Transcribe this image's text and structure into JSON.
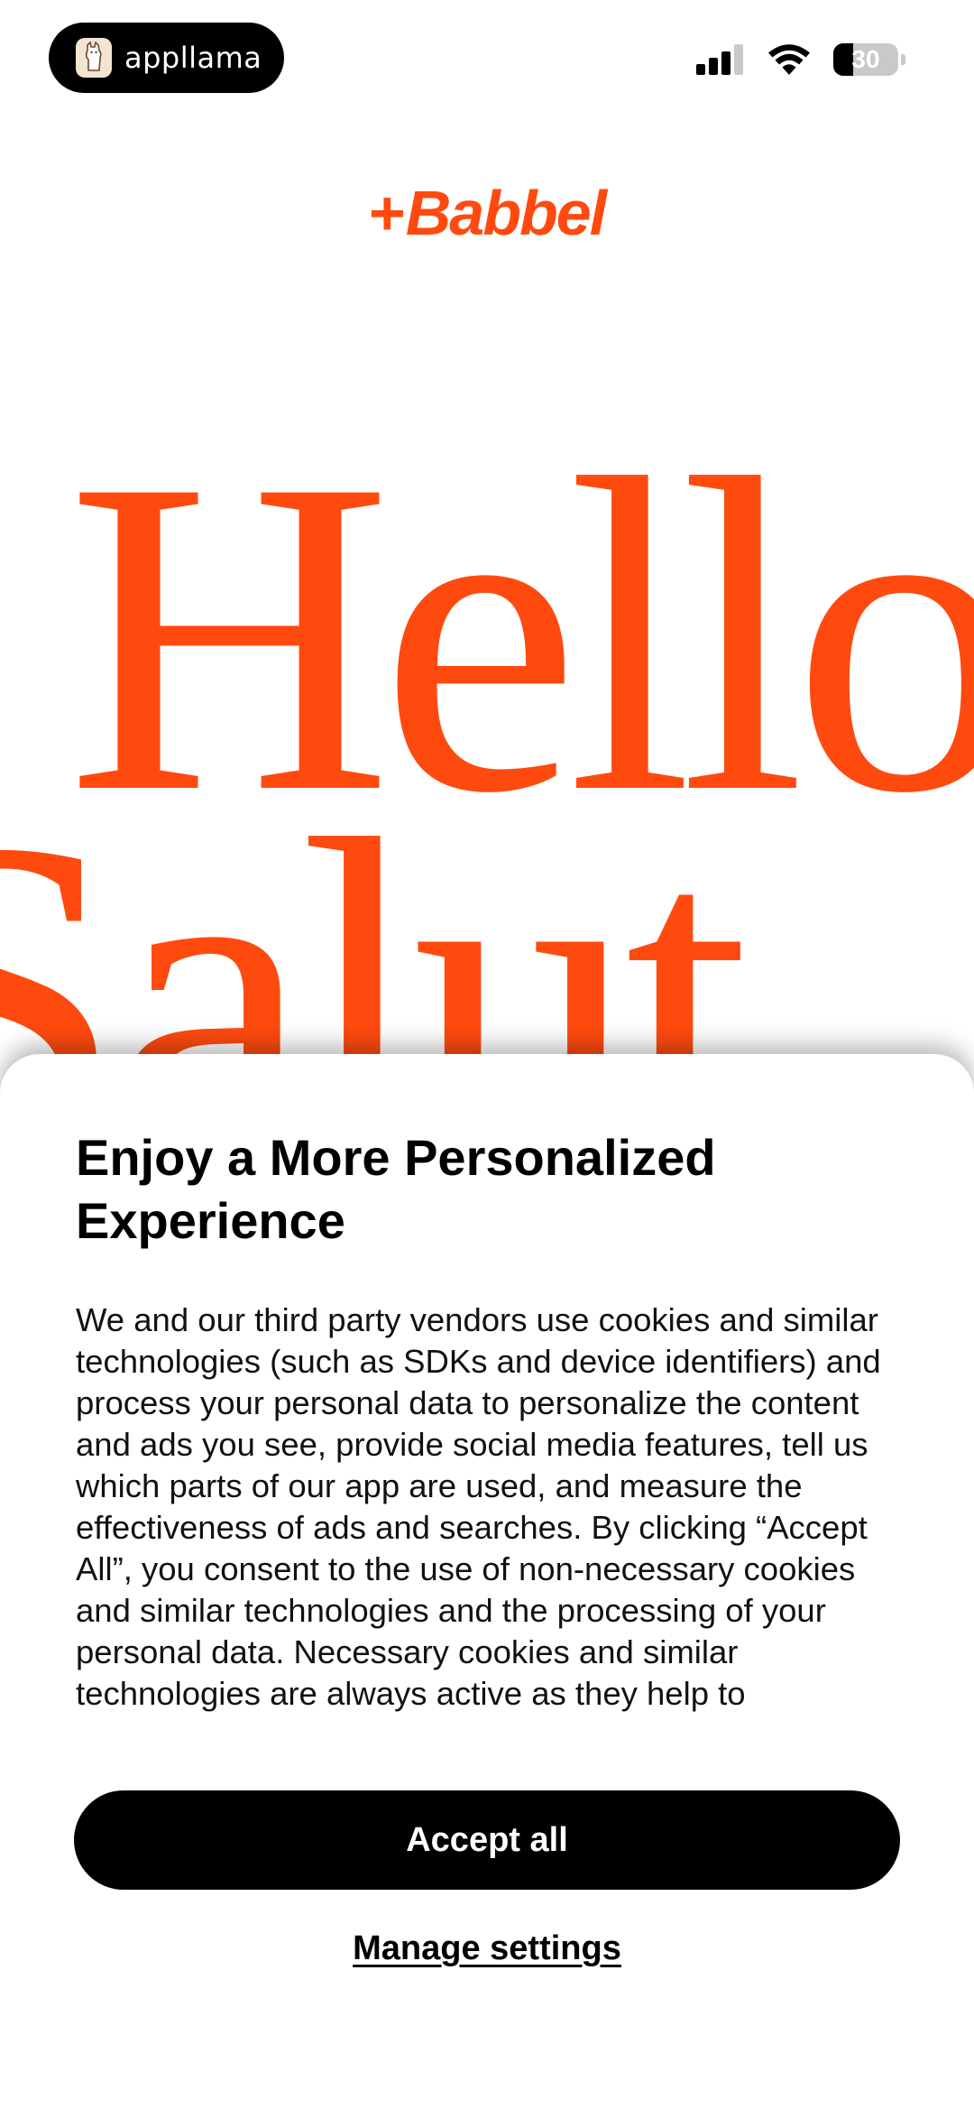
{
  "status_bar": {
    "app_badge": "appllama",
    "battery_level": "30",
    "battery_fraction": 0.3
  },
  "brand": {
    "name": "Babbel",
    "color": "#ff4a0f"
  },
  "hero": {
    "words": [
      "Hello",
      "Salut"
    ]
  },
  "consent": {
    "title": "Enjoy a More Personalized Experience",
    "body": "We and our third party vendors use cookies and similar technologies (such as SDKs and device identifiers) and process your personal data to personalize the content and ads you see, provide social media features, tell us which parts of our app are used, and measure the effectiveness of ads and searches. By clicking “Accept All”, you consent to the use of non-necessary cookies and similar technologies and the processing of your personal data. Necessary cookies and similar technologies are always active as they help to",
    "accept_label": "Accept all",
    "manage_label": "Manage settings"
  },
  "icons": {
    "signal": "cellular-signal-icon",
    "wifi": "wifi-icon",
    "battery": "battery-icon",
    "badge_logo": "llama-icon"
  }
}
